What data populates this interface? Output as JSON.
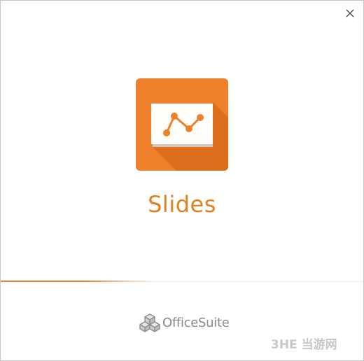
{
  "splash": {
    "app_name": "Slides",
    "accent_color": "#ee7f2b",
    "title_color": "#e1801f",
    "close_icon": "close-icon",
    "app_icon": "presentation-chart-icon",
    "loading_progress": 0.42
  },
  "footer": {
    "brand_name": "OfficeSuite",
    "brand_icon": "officesuite-cubes-icon"
  },
  "watermark": {
    "text": "3HE 当游网"
  }
}
